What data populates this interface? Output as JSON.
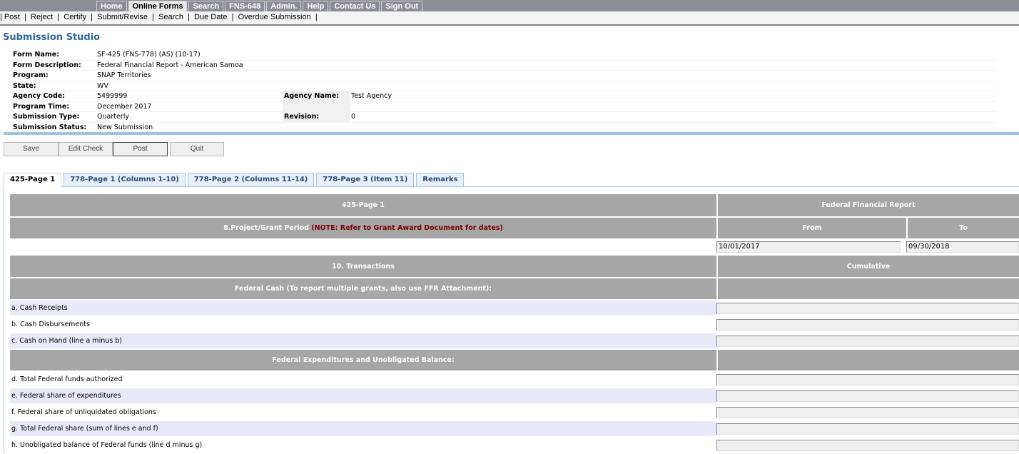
{
  "topnav": [
    "Home",
    "Online Forms",
    "Search",
    "FNS-648",
    "Admin.",
    "Help",
    "Contact Us",
    "Sign Out"
  ],
  "subnav": "| Post  |  Reject  |  Certify  |  Submit/Revise  |  Search  |  Due Date  |  Overdue Submission  |",
  "title": "Submission Studio",
  "info": {
    "form_name_l": "Form Name:",
    "form_name": "SF-425 (FNS-778) (AS) (10-17)",
    "form_desc_l": "Form Description:",
    "form_desc": "Federal Financial Report - American Samoa",
    "program_l": "Program:",
    "program": "SNAP Territories",
    "state_l": "State:",
    "state": "WV",
    "agency_code_l": "Agency Code:",
    "agency_code": "5499999",
    "agency_name_l": "Agency Name:",
    "agency_name": "Test Agency",
    "program_time_l": "Program Time:",
    "program_time": "December 2017",
    "sub_type_l": "Submission Type:",
    "sub_type": "Quarterly",
    "revision_l": "Revision:",
    "revision": "0",
    "sub_status_l": "Submission Status:",
    "sub_status": "New Submission"
  },
  "actions": {
    "save": "Save",
    "edit_check": "Edit Check",
    "post": "Post",
    "quit": "Quit"
  },
  "tabs": [
    "425-Page 1",
    "778-Page 1 (Columns 1-10)",
    "778-Page 2 (Columns 11-14)",
    "778-Page 3 (Item 11)",
    "Remarks"
  ],
  "form": {
    "page_header": "425-Page 1",
    "report_header": "Federal Financial Report",
    "period_label": "8.Project/Grant Period",
    "period_note": "(NOTE: Refer to Grant Award Document for dates)",
    "from": "From",
    "to": "To",
    "from_value": "10/01/2017",
    "to_value": "09/30/2018",
    "transactions": "10. Transactions",
    "cumulative": "Cumulative",
    "cash_section": "Federal Cash (To report multiple grants, also use FFR Attachment):",
    "cash_rows": [
      "a. Cash Receipts",
      "b. Cash Disbursements",
      "c. Cash on Hand (line a minus b)"
    ],
    "exp_section": "Federal Expenditures and Unobligated Balance:",
    "exp_rows": [
      "d. Total Federal funds authorized",
      "e. Federal share of expenditures",
      "f. Federal share of unliquidated obligations",
      "g. Total Federal share (sum of lines e and f)",
      "h. Unobligated balance of Federal funds (line d minus g)"
    ]
  }
}
